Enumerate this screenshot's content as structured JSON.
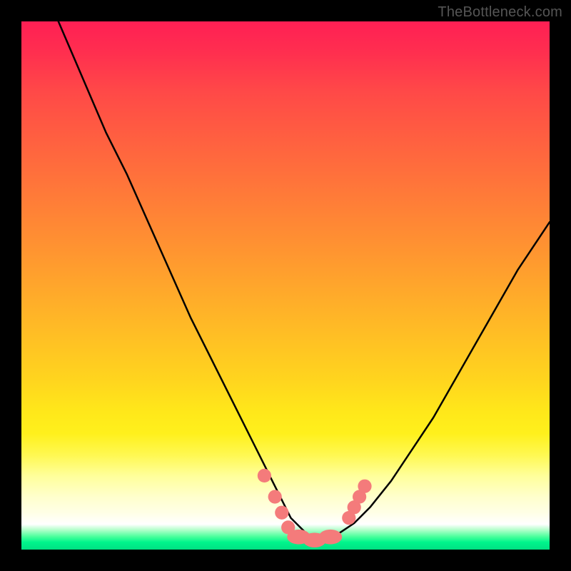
{
  "watermark": "TheBottleneck.com",
  "colors": {
    "background": "#000000",
    "marker": "#f47b7b",
    "curve": "#000000"
  },
  "chart_data": {
    "type": "line",
    "title": "",
    "xlabel": "",
    "ylabel": "",
    "xlim": [
      0,
      100
    ],
    "ylim": [
      0,
      100
    ],
    "grid": false,
    "legend": false,
    "note": "Values estimated from pixel positions on a 0–100 normalized axis. Curve is a V-shape with minimum near x≈55, y≈2. Left branch descends from off-chart; right branch ascends to ~y≈60. Salmon markers cluster along the trough.",
    "series": [
      {
        "name": "curve",
        "x": [
          7,
          10,
          13,
          16,
          20,
          24,
          28,
          32,
          36,
          40,
          44,
          48,
          51,
          54,
          57,
          60,
          63,
          66,
          70,
          74,
          78,
          82,
          86,
          90,
          94,
          98,
          100
        ],
        "y": [
          100,
          93,
          86,
          79,
          71,
          62,
          53,
          44,
          36,
          28,
          20,
          12,
          6,
          3,
          2,
          3,
          5,
          8,
          13,
          19,
          25,
          32,
          39,
          46,
          53,
          59,
          62
        ]
      }
    ],
    "markers": [
      {
        "x": 46.0,
        "y": 14.0,
        "r": 1.3
      },
      {
        "x": 48.0,
        "y": 10.0,
        "r": 1.3
      },
      {
        "x": 49.3,
        "y": 7.0,
        "r": 1.3
      },
      {
        "x": 50.5,
        "y": 4.2,
        "r": 1.3
      },
      {
        "x": 52.5,
        "y": 2.4,
        "r_x": 2.2,
        "r_y": 1.4
      },
      {
        "x": 55.5,
        "y": 1.8,
        "r_x": 2.2,
        "r_y": 1.4
      },
      {
        "x": 58.5,
        "y": 2.4,
        "r_x": 2.2,
        "r_y": 1.4
      },
      {
        "x": 62.0,
        "y": 6.0,
        "r": 1.3
      },
      {
        "x": 63.0,
        "y": 8.0,
        "r": 1.3
      },
      {
        "x": 64.0,
        "y": 10.0,
        "r": 1.3
      },
      {
        "x": 65.0,
        "y": 12.0,
        "r": 1.3
      }
    ]
  }
}
